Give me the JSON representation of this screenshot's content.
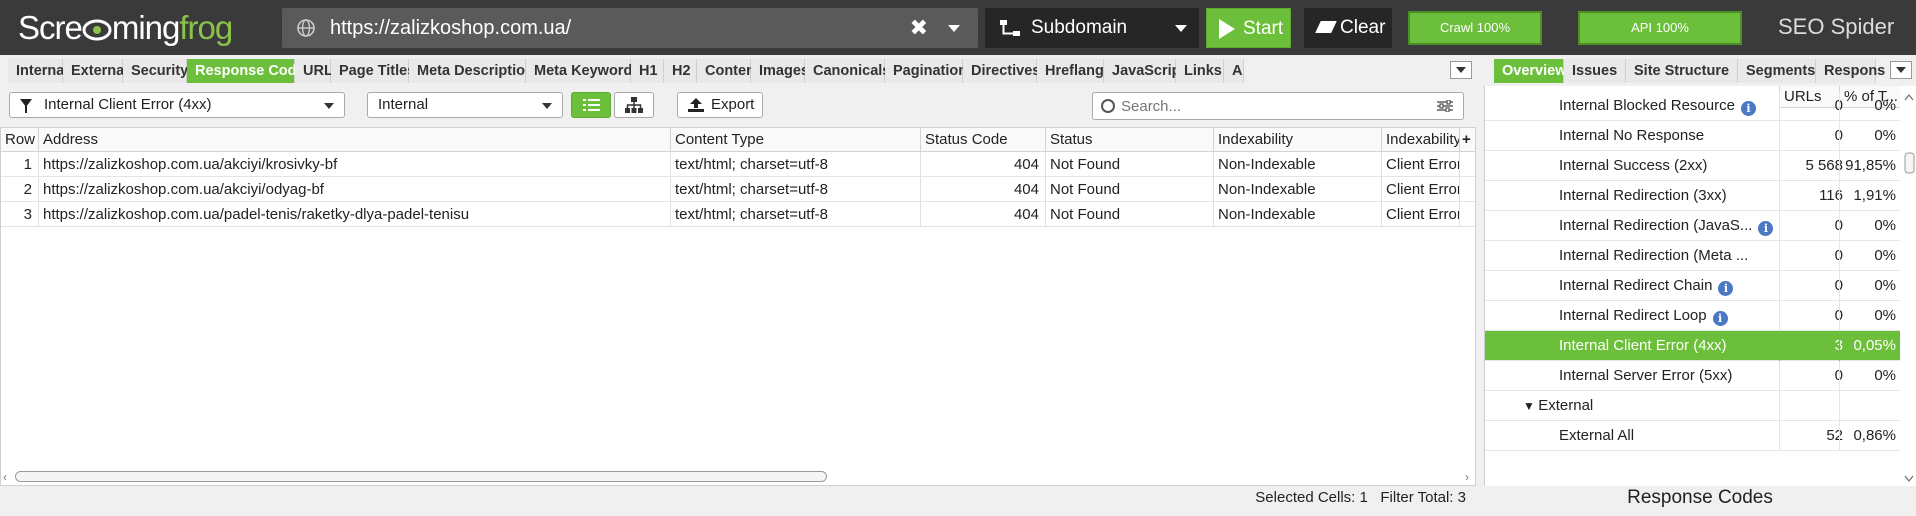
{
  "app": {
    "logo_part1": "Scre",
    "logo_part2": "ming",
    "logo_part3": "frog",
    "brand": "SEO Spider"
  },
  "topbar": {
    "url": "https://zalizkoshop.com.ua/",
    "mode": "Subdomain",
    "start_label": "Start",
    "clear_label": "Clear",
    "crawl_progress_label": "Crawl 100%",
    "crawl_progress": 1.0,
    "api_progress_label": "API 100%",
    "api_progress": 1.0,
    "accent_color": "#6cbf3a"
  },
  "tabs": [
    "Internal",
    "External",
    "Security",
    "Response Codes",
    "URL",
    "Page Titles",
    "Meta Description",
    "Meta Keywords",
    "H1",
    "H2",
    "Content",
    "Images",
    "Canonicals",
    "Pagination",
    "Directives",
    "Hreflang",
    "JavaScript",
    "Links",
    "A"
  ],
  "active_tab": "Response Codes",
  "right_tabs": [
    "Overview",
    "Issues",
    "Site Structure",
    "Segments",
    "Respons"
  ],
  "active_right_tab": "Overview",
  "filters": {
    "filter_value": "Internal Client Error (4xx)",
    "scope_value": "Internal",
    "export_label": "Export",
    "search_placeholder": "Search..."
  },
  "table": {
    "columns": [
      "Row",
      "Address",
      "Content Type",
      "Status Code",
      "Status",
      "Indexability",
      "Indexability"
    ],
    "rows": [
      [
        "1",
        "https://zalizkoshop.com.ua/akciyi/krosivky-bf",
        "text/html; charset=utf-8",
        "404",
        "Not Found",
        "Non-Indexable",
        "Client Error"
      ],
      [
        "2",
        "https://zalizkoshop.com.ua/akciyi/odyag-bf",
        "text/html; charset=utf-8",
        "404",
        "Not Found",
        "Non-Indexable",
        "Client Error"
      ],
      [
        "3",
        "https://zalizkoshop.com.ua/padel-tenis/raketky-dlya-padel-tenisu",
        "text/html; charset=utf-8",
        "404",
        "Not Found",
        "Non-Indexable",
        "Client Error"
      ]
    ]
  },
  "status": {
    "selected_cells_label": "Selected Cells:",
    "selected_cells": "1",
    "filter_total_label": "Filter Total:",
    "filter_total": "3"
  },
  "overview": {
    "columns": [
      "URLs",
      "% of T..."
    ],
    "rows": [
      {
        "label": "Internal Blocked Resource",
        "info": true,
        "urls": "0",
        "pct": "0%"
      },
      {
        "label": "Internal No Response",
        "info": false,
        "urls": "0",
        "pct": "0%"
      },
      {
        "label": "Internal Success (2xx)",
        "info": false,
        "urls": "5 568",
        "pct": "91,85%"
      },
      {
        "label": "Internal Redirection (3xx)",
        "info": false,
        "urls": "116",
        "pct": "1,91%"
      },
      {
        "label": "Internal Redirection (JavaS...",
        "info": true,
        "urls": "0",
        "pct": "0%"
      },
      {
        "label": "Internal Redirection (Meta ...",
        "info": false,
        "urls": "0",
        "pct": "0%"
      },
      {
        "label": "Internal Redirect Chain",
        "info": true,
        "urls": "0",
        "pct": "0%"
      },
      {
        "label": "Internal Redirect Loop",
        "info": true,
        "urls": "0",
        "pct": "0%"
      },
      {
        "label": "Internal Client Error (4xx)",
        "info": false,
        "urls": "3",
        "pct": "0,05%"
      },
      {
        "label": "Internal Server Error (5xx)",
        "info": false,
        "urls": "0",
        "pct": "0%"
      },
      {
        "label": "External",
        "info": false,
        "urls": "",
        "pct": ""
      },
      {
        "label": "External All",
        "info": false,
        "urls": "52",
        "pct": "0,86%"
      }
    ],
    "selected_row": "Internal Client Error (4xx)",
    "caption": "Response Codes"
  }
}
